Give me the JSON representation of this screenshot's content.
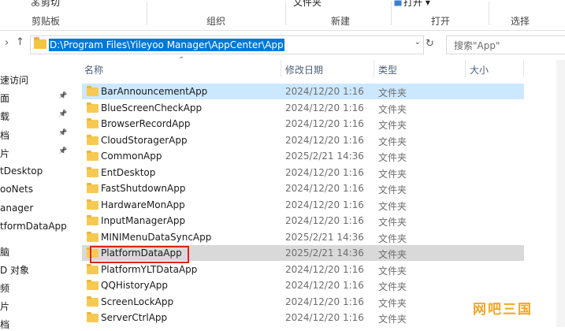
{
  "ribbon": {
    "top_items": [
      {
        "label": "剪切",
        "icon": "scissors-icon"
      },
      {
        "label": "文件夹"
      },
      {
        "label": "打开 ▾",
        "icon": "open-icon"
      }
    ],
    "groups": [
      "剪贴板",
      "组织",
      "新建",
      "打开",
      "选择"
    ]
  },
  "address": {
    "path": "D:\\Program Files\\Yileyoo Manager\\AppCenter\\App",
    "search_placeholder": "搜索\"App\""
  },
  "nav": {
    "back_icon": "back-arrow-icon",
    "up_icon": "up-arrow-icon",
    "items": [
      {
        "label": "速访问",
        "pinned": false
      },
      {
        "label": "面",
        "pinned": true
      },
      {
        "label": "载",
        "pinned": true
      },
      {
        "label": "档",
        "pinned": true
      },
      {
        "label": "片",
        "pinned": true
      },
      {
        "label": "tDesktop",
        "pinned": false
      },
      {
        "label": "ooNets",
        "pinned": false
      },
      {
        "label": "anager",
        "pinned": false
      },
      {
        "label": "tformDataApp",
        "pinned": false
      },
      {
        "label": "脑",
        "pinned": false
      },
      {
        "label": "D 对象",
        "pinned": false
      },
      {
        "label": "频",
        "pinned": false
      },
      {
        "label": "片",
        "pinned": false
      },
      {
        "label": "档",
        "pinned": false
      }
    ]
  },
  "columns": {
    "name": "名称",
    "date": "修改日期",
    "type": "类型",
    "size": "大小"
  },
  "files": [
    {
      "name": "BarAnnouncementApp",
      "date": "2024/12/20 1:16",
      "type": "文件夹",
      "state": "selected"
    },
    {
      "name": "BlueScreenCheckApp",
      "date": "2024/12/20 1:16",
      "type": "文件夹",
      "state": ""
    },
    {
      "name": "BrowserRecordApp",
      "date": "2024/12/20 1:16",
      "type": "文件夹",
      "state": ""
    },
    {
      "name": "CloudStoragerApp",
      "date": "2024/12/20 1:16",
      "type": "文件夹",
      "state": ""
    },
    {
      "name": "CommonApp",
      "date": "2025/2/21 14:36",
      "type": "文件夹",
      "state": ""
    },
    {
      "name": "EntDesktop",
      "date": "2024/12/20 1:16",
      "type": "文件夹",
      "state": ""
    },
    {
      "name": "FastShutdownApp",
      "date": "2024/12/20 1:16",
      "type": "文件夹",
      "state": ""
    },
    {
      "name": "HardwareMonApp",
      "date": "2024/12/20 1:16",
      "type": "文件夹",
      "state": ""
    },
    {
      "name": "InputManagerApp",
      "date": "2024/12/20 1:16",
      "type": "文件夹",
      "state": ""
    },
    {
      "name": "MINIMenuDataSyncApp",
      "date": "2025/2/21 14:36",
      "type": "文件夹",
      "state": ""
    },
    {
      "name": "PlatformDataApp",
      "date": "2025/2/21 14:36",
      "type": "文件夹",
      "state": "hover"
    },
    {
      "name": "PlatformYLTDataApp",
      "date": "2024/12/20 1:16",
      "type": "文件夹",
      "state": ""
    },
    {
      "name": "QQHistoryApp",
      "date": "2024/12/20 1:16",
      "type": "文件夹",
      "state": ""
    },
    {
      "name": "ScreenLockApp",
      "date": "2024/12/20 1:16",
      "type": "文件夹",
      "state": ""
    },
    {
      "name": "ServerCtrlApp",
      "date": "2024/12/20 1:16",
      "type": "文件夹",
      "state": ""
    }
  ],
  "watermark": "网吧三国",
  "colors": {
    "selection": "#cce8ff",
    "hover": "#d9d9d9",
    "accent": "#0078d7",
    "highlight_border": "#e02020",
    "folder": "#f6ca52"
  }
}
